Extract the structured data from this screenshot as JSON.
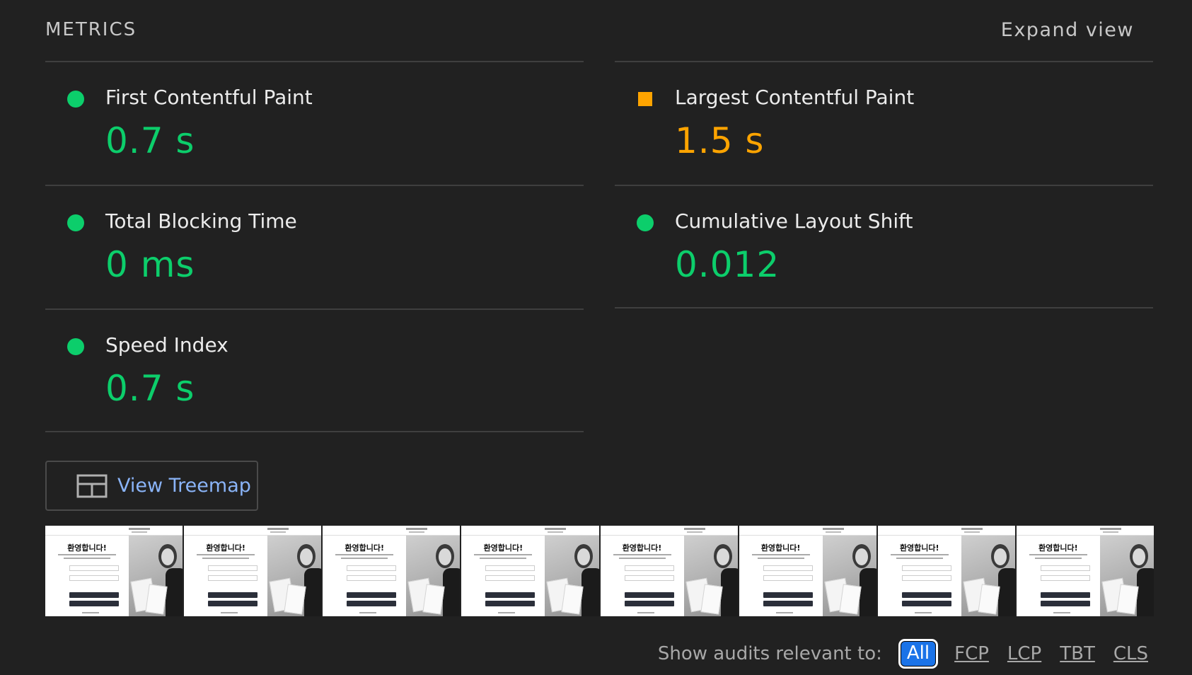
{
  "header": {
    "title": "METRICS",
    "expand_label": "Expand view"
  },
  "metrics_left": [
    {
      "label": "First Contentful Paint",
      "value": "0.7 s",
      "status": "good"
    },
    {
      "label": "Total Blocking Time",
      "value": "0 ms",
      "status": "good"
    },
    {
      "label": "Speed Index",
      "value": "0.7 s",
      "status": "good"
    }
  ],
  "metrics_right": [
    {
      "label": "Largest Contentful Paint",
      "value": "1.5 s",
      "status": "average"
    },
    {
      "label": "Cumulative Layout Shift",
      "value": "0.012",
      "status": "good"
    }
  ],
  "treemap": {
    "label": "View Treemap"
  },
  "filmstrip": {
    "frame_count": 8,
    "frame_heading": "환영합니다!"
  },
  "audits": {
    "label": "Show audits relevant to:",
    "filters": [
      "All",
      "FCP",
      "LCP",
      "TBT",
      "CLS"
    ],
    "active": "All"
  },
  "colors": {
    "background": "#212121",
    "good": "#0cce6b",
    "average": "#ffa400",
    "link": "#8ab4f8",
    "active_chip": "#1a73e8"
  },
  "icons": {
    "good": "green-circle-icon",
    "average": "orange-square-icon",
    "treemap": "treemap-icon"
  }
}
